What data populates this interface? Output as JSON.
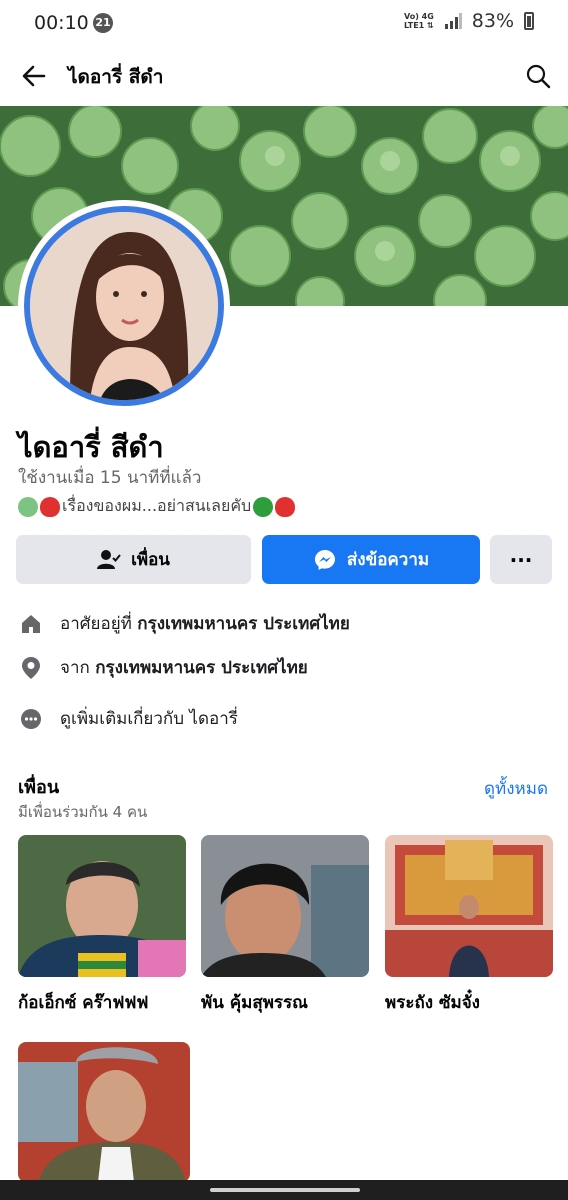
{
  "status_bar": {
    "time": "00:10",
    "notification_count": "21",
    "network_top": "Vo) 4G",
    "network_bottom": "LTE1 ⇅",
    "battery": "83%"
  },
  "header": {
    "title": "ไดอารี่ สีดำ",
    "icons": {
      "back": "arrow-left-icon",
      "search": "search-icon"
    }
  },
  "profile": {
    "name": "ไดอารี่ สีดำ",
    "active_status": "ใช้งานเมื่อ 15 นาทีที่แล้ว",
    "bio": "เรื่องของผม...อย่าสนเลยคับ"
  },
  "actions": {
    "friend_label": "เพื่อน",
    "message_label": "ส่งข้อความ",
    "more_label": "···",
    "colors": {
      "primary": "#1877f2",
      "secondary": "#e4e6eb"
    }
  },
  "info": {
    "lives_prefix": "อาศัยอยู่ที่",
    "lives_place": "กรุงเทพมหานคร ประเทศไทย",
    "from_prefix": "จาก",
    "from_place": "กรุงเทพมหานคร ประเทศไทย",
    "see_more": "ดูเพิ่มเติมเกี่ยวกับ ไดอารี่"
  },
  "friends": {
    "title": "เพื่อน",
    "mutual": "มีเพื่อนร่วมกัน 4 คน",
    "see_all": "ดูทั้งหมด",
    "items": [
      {
        "name": "ก้อเอ็กซ์ คร๊าฟฟฟ"
      },
      {
        "name": "พัน คุ้มสุพรรณ"
      },
      {
        "name": "พระถัง ซัมจั๋ง"
      },
      {
        "name": ""
      }
    ]
  }
}
